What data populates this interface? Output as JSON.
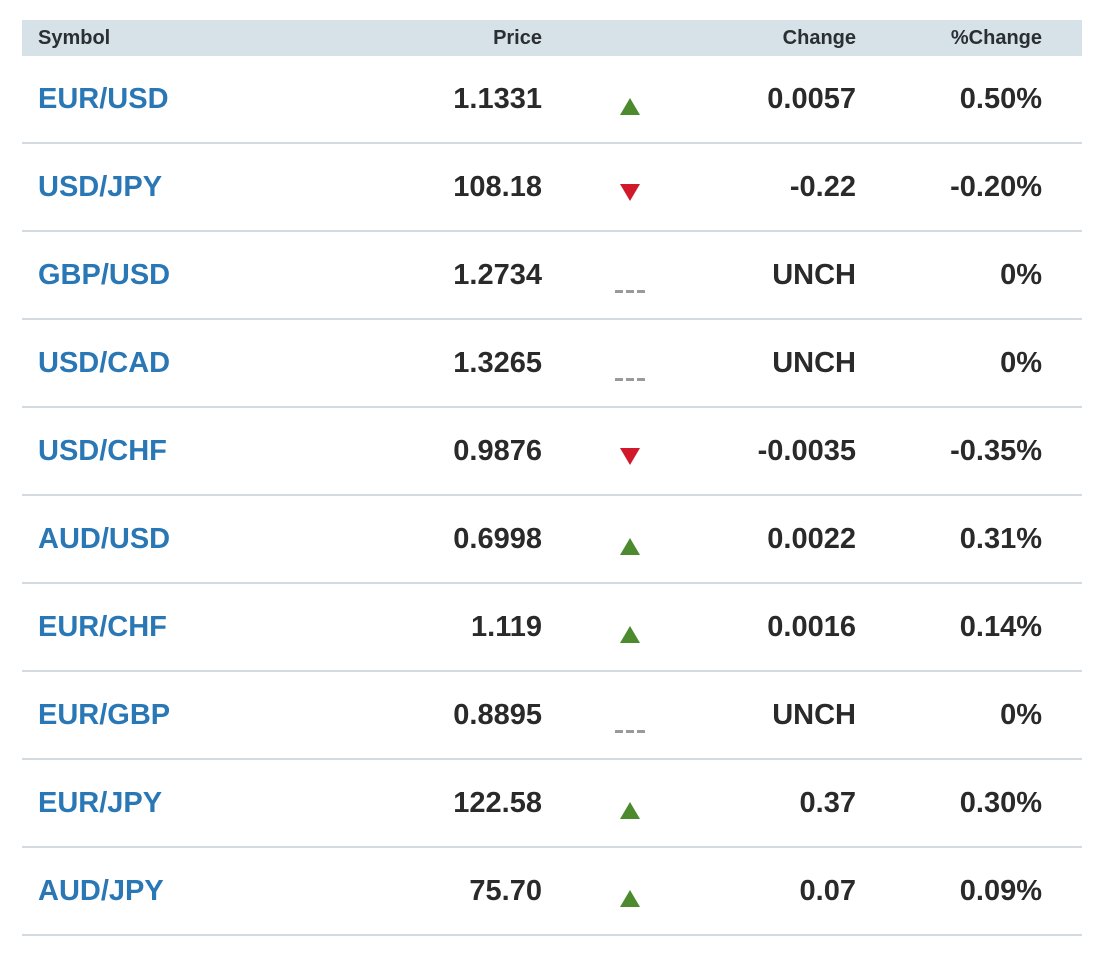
{
  "table": {
    "headers": {
      "symbol": "Symbol",
      "price": "Price",
      "change": "Change",
      "pct_change": "%Change"
    },
    "rows": [
      {
        "symbol": "EUR/USD",
        "price": "1.1331",
        "direction": "up",
        "change": "0.0057",
        "pct_change": "0.50%"
      },
      {
        "symbol": "USD/JPY",
        "price": "108.18",
        "direction": "down",
        "change": "-0.22",
        "pct_change": "-0.20%"
      },
      {
        "symbol": "GBP/USD",
        "price": "1.2734",
        "direction": "flat",
        "change": "UNCH",
        "pct_change": "0%"
      },
      {
        "symbol": "USD/CAD",
        "price": "1.3265",
        "direction": "flat",
        "change": "UNCH",
        "pct_change": "0%"
      },
      {
        "symbol": "USD/CHF",
        "price": "0.9876",
        "direction": "down",
        "change": "-0.0035",
        "pct_change": "-0.35%"
      },
      {
        "symbol": "AUD/USD",
        "price": "0.6998",
        "direction": "up",
        "change": "0.0022",
        "pct_change": "0.31%"
      },
      {
        "symbol": "EUR/CHF",
        "price": "1.119",
        "direction": "up",
        "change": "0.0016",
        "pct_change": "0.14%"
      },
      {
        "symbol": "EUR/GBP",
        "price": "0.8895",
        "direction": "flat",
        "change": "UNCH",
        "pct_change": "0%"
      },
      {
        "symbol": "EUR/JPY",
        "price": "122.58",
        "direction": "up",
        "change": "0.37",
        "pct_change": "0.30%"
      },
      {
        "symbol": "AUD/JPY",
        "price": "75.70",
        "direction": "up",
        "change": "0.07",
        "pct_change": "0.09%"
      }
    ]
  },
  "colors": {
    "link": "#2a77b5",
    "up": "#4d8a2e",
    "down": "#d0192b",
    "flat": "#9a9a9a",
    "header_bg": "#d6e1e8"
  },
  "icons": {
    "up": "triangle-up-icon",
    "down": "triangle-down-icon",
    "flat": "dash-icon"
  }
}
